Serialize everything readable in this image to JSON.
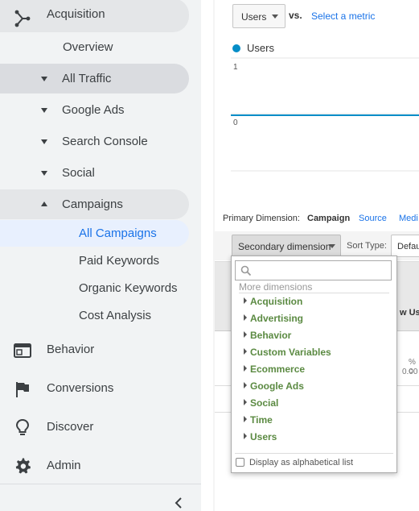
{
  "sidebar": {
    "acquisition": "Acquisition",
    "overview": "Overview",
    "all_traffic": "All Traffic",
    "google_ads": "Google Ads",
    "search_console": "Search Console",
    "social": "Social",
    "campaigns": "Campaigns",
    "all_campaigns": "All Campaigns",
    "paid_keywords": "Paid Keywords",
    "organic_keywords": "Organic Keywords",
    "cost_analysis": "Cost Analysis",
    "behavior": "Behavior",
    "conversions": "Conversions",
    "discover": "Discover",
    "admin": "Admin"
  },
  "chart": {
    "metric_select": "Users",
    "vs": "vs.",
    "select_metric": "Select a metric",
    "legend": "Users",
    "y_top": "1",
    "y_bottom": "0",
    "series_color": "#058dc7"
  },
  "dimensions": {
    "label": "Primary Dimension:",
    "campaign": "Campaign",
    "source": "Source",
    "medium": "Medi"
  },
  "toolbar": {
    "secondary_dimension": "Secondary dimension",
    "sort_type": "Sort Type:",
    "sort_value": "Defau"
  },
  "table": {
    "new_users_header": "w Use",
    "pct": "% c",
    "zero": "0.00"
  },
  "dropdown": {
    "search_placeholder": "",
    "heading": "More dimensions",
    "items": [
      "Acquisition",
      "Advertising",
      "Behavior",
      "Custom Variables",
      "Ecommerce",
      "Google Ads",
      "Social",
      "Time",
      "Users"
    ],
    "alphabetical": "Display as alphabetical list"
  }
}
